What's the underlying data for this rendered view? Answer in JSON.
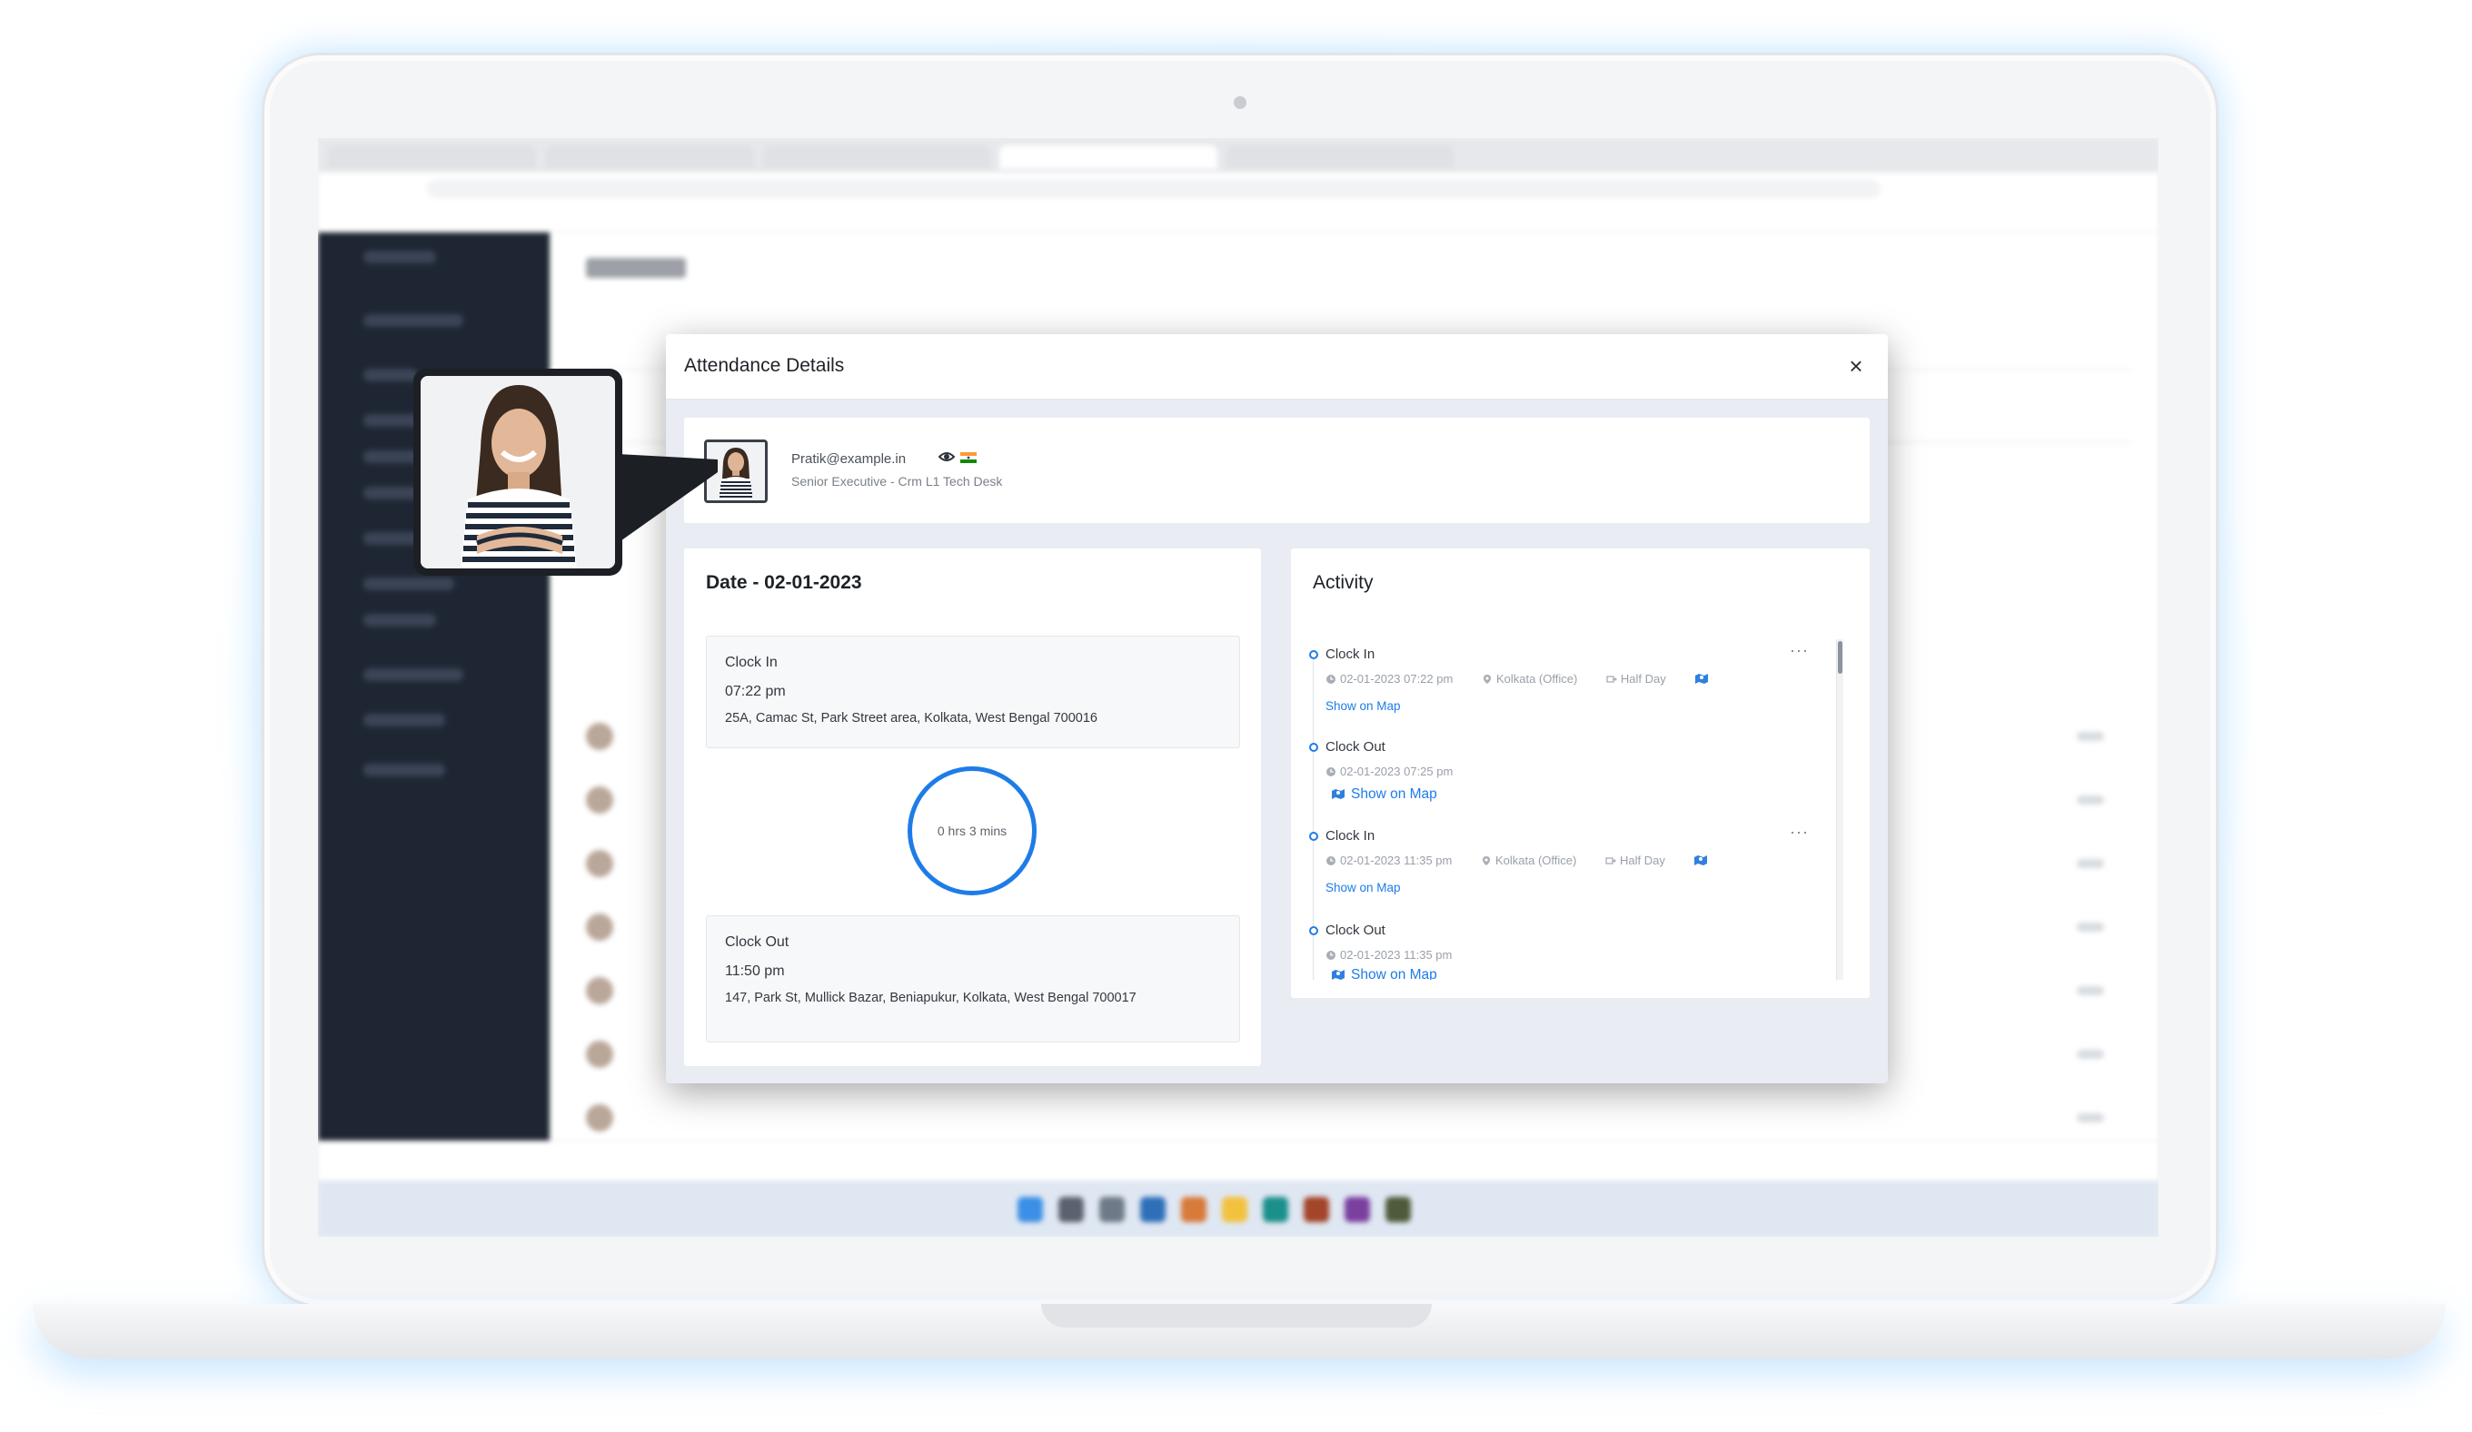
{
  "modal": {
    "title": "Attendance Details",
    "close_label": "×"
  },
  "profile": {
    "email": "Pratik@example.in",
    "role": "Senior Executive - Crm L1 Tech Desk"
  },
  "date_panel": {
    "title": "Date - 02-01-2023",
    "clock_in": {
      "label": "Clock In",
      "time": "07:22 pm",
      "address": "25A, Camac St, Park Street area, Kolkata, West Bengal 700016"
    },
    "duration": "0 hrs 3 mins",
    "clock_out": {
      "label": "Clock Out",
      "time": "11:50 pm",
      "address": "147, Park St, Mullick Bazar, Beniapukur, Kolkata, West Bengal 700017"
    }
  },
  "activity": {
    "title": "Activity",
    "items": [
      {
        "title": "Clock In",
        "timestamp": "02-01-2023 07:22 pm",
        "location": "Kolkata (Office)",
        "shift": "Half Day",
        "link": "Show on Map"
      },
      {
        "title": "Clock Out",
        "timestamp": "02-01-2023 07:25 pm",
        "link": "Show on Map"
      },
      {
        "title": "Clock In",
        "timestamp": "02-01-2023 11:35 pm",
        "location": "Kolkata (Office)",
        "shift": "Half Day",
        "link": "Show on Map"
      },
      {
        "title": "Clock Out",
        "timestamp": "02-01-2023 11:35 pm",
        "link": "Show on Map"
      }
    ],
    "more_label": "···"
  },
  "icons": {
    "close": "close-icon",
    "eye": "eye-icon",
    "flag": "india-flag-icon",
    "clock": "clock-icon",
    "location": "location-pin-icon",
    "shift": "half-day-icon",
    "map": "map-icon",
    "more": "more-dots-icon"
  },
  "colors": {
    "accent": "#1e7ce8",
    "sidebar": "#1f2633",
    "modal_bg": "#e9edf3"
  }
}
